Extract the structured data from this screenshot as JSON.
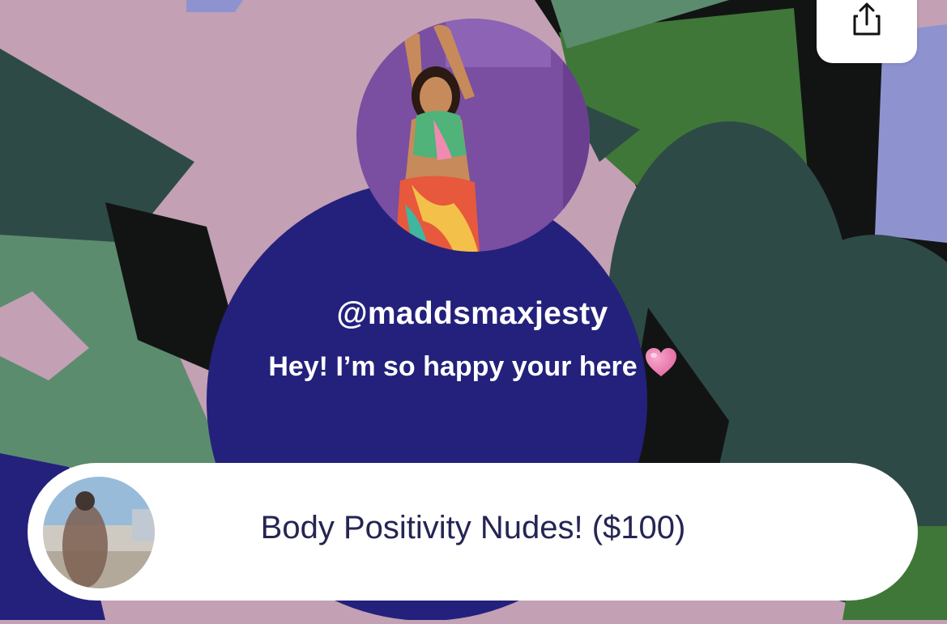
{
  "profile": {
    "username": "@maddsmaxjesty",
    "bio": "Hey! I’m so happy your here",
    "bio_emoji": "pink-heart",
    "avatar_image": "profile-photo-woman-against-purple-wall"
  },
  "share": {
    "icon": "share-icon"
  },
  "links": [
    {
      "label": "Body Positivity Nudes! ($100)",
      "thumbnail": "blurred-photo-thumbnail"
    }
  ],
  "colors": {
    "link_text": "#252554",
    "text_on_background": "#ffffff",
    "background_navy": "#24217c",
    "background_pink": "#c3a0b4",
    "background_green": "#5b8c6e",
    "background_dark_teal": "#2e4a46",
    "background_periwinkle": "#8e93d0",
    "heart": "#e46aa3"
  }
}
